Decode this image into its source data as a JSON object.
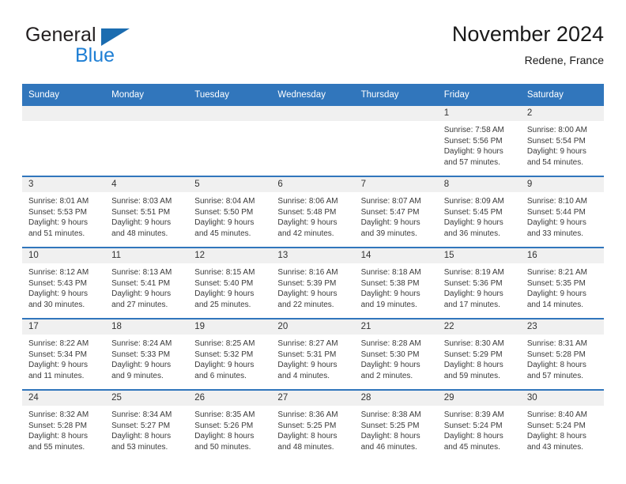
{
  "brand": {
    "line1": "General",
    "line2": "Blue",
    "logo_icon": "triangle-logo-icon",
    "accent_color": "#1f7fd4"
  },
  "header": {
    "title": "November 2024",
    "subtitle": "Redene, France"
  },
  "theme": {
    "header_blue": "#3176bc",
    "daynum_band": "#f0f0f0",
    "text": "#333333"
  },
  "calendar": {
    "weekday_headers": [
      "Sunday",
      "Monday",
      "Tuesday",
      "Wednesday",
      "Thursday",
      "Friday",
      "Saturday"
    ],
    "weeks": [
      [
        {
          "day": "",
          "sunrise": "",
          "sunset": "",
          "daylight": ""
        },
        {
          "day": "",
          "sunrise": "",
          "sunset": "",
          "daylight": ""
        },
        {
          "day": "",
          "sunrise": "",
          "sunset": "",
          "daylight": ""
        },
        {
          "day": "",
          "sunrise": "",
          "sunset": "",
          "daylight": ""
        },
        {
          "day": "",
          "sunrise": "",
          "sunset": "",
          "daylight": ""
        },
        {
          "day": "1",
          "sunrise": "Sunrise: 7:58 AM",
          "sunset": "Sunset: 5:56 PM",
          "daylight": "Daylight: 9 hours and 57 minutes."
        },
        {
          "day": "2",
          "sunrise": "Sunrise: 8:00 AM",
          "sunset": "Sunset: 5:54 PM",
          "daylight": "Daylight: 9 hours and 54 minutes."
        }
      ],
      [
        {
          "day": "3",
          "sunrise": "Sunrise: 8:01 AM",
          "sunset": "Sunset: 5:53 PM",
          "daylight": "Daylight: 9 hours and 51 minutes."
        },
        {
          "day": "4",
          "sunrise": "Sunrise: 8:03 AM",
          "sunset": "Sunset: 5:51 PM",
          "daylight": "Daylight: 9 hours and 48 minutes."
        },
        {
          "day": "5",
          "sunrise": "Sunrise: 8:04 AM",
          "sunset": "Sunset: 5:50 PM",
          "daylight": "Daylight: 9 hours and 45 minutes."
        },
        {
          "day": "6",
          "sunrise": "Sunrise: 8:06 AM",
          "sunset": "Sunset: 5:48 PM",
          "daylight": "Daylight: 9 hours and 42 minutes."
        },
        {
          "day": "7",
          "sunrise": "Sunrise: 8:07 AM",
          "sunset": "Sunset: 5:47 PM",
          "daylight": "Daylight: 9 hours and 39 minutes."
        },
        {
          "day": "8",
          "sunrise": "Sunrise: 8:09 AM",
          "sunset": "Sunset: 5:45 PM",
          "daylight": "Daylight: 9 hours and 36 minutes."
        },
        {
          "day": "9",
          "sunrise": "Sunrise: 8:10 AM",
          "sunset": "Sunset: 5:44 PM",
          "daylight": "Daylight: 9 hours and 33 minutes."
        }
      ],
      [
        {
          "day": "10",
          "sunrise": "Sunrise: 8:12 AM",
          "sunset": "Sunset: 5:43 PM",
          "daylight": "Daylight: 9 hours and 30 minutes."
        },
        {
          "day": "11",
          "sunrise": "Sunrise: 8:13 AM",
          "sunset": "Sunset: 5:41 PM",
          "daylight": "Daylight: 9 hours and 27 minutes."
        },
        {
          "day": "12",
          "sunrise": "Sunrise: 8:15 AM",
          "sunset": "Sunset: 5:40 PM",
          "daylight": "Daylight: 9 hours and 25 minutes."
        },
        {
          "day": "13",
          "sunrise": "Sunrise: 8:16 AM",
          "sunset": "Sunset: 5:39 PM",
          "daylight": "Daylight: 9 hours and 22 minutes."
        },
        {
          "day": "14",
          "sunrise": "Sunrise: 8:18 AM",
          "sunset": "Sunset: 5:38 PM",
          "daylight": "Daylight: 9 hours and 19 minutes."
        },
        {
          "day": "15",
          "sunrise": "Sunrise: 8:19 AM",
          "sunset": "Sunset: 5:36 PM",
          "daylight": "Daylight: 9 hours and 17 minutes."
        },
        {
          "day": "16",
          "sunrise": "Sunrise: 8:21 AM",
          "sunset": "Sunset: 5:35 PM",
          "daylight": "Daylight: 9 hours and 14 minutes."
        }
      ],
      [
        {
          "day": "17",
          "sunrise": "Sunrise: 8:22 AM",
          "sunset": "Sunset: 5:34 PM",
          "daylight": "Daylight: 9 hours and 11 minutes."
        },
        {
          "day": "18",
          "sunrise": "Sunrise: 8:24 AM",
          "sunset": "Sunset: 5:33 PM",
          "daylight": "Daylight: 9 hours and 9 minutes."
        },
        {
          "day": "19",
          "sunrise": "Sunrise: 8:25 AM",
          "sunset": "Sunset: 5:32 PM",
          "daylight": "Daylight: 9 hours and 6 minutes."
        },
        {
          "day": "20",
          "sunrise": "Sunrise: 8:27 AM",
          "sunset": "Sunset: 5:31 PM",
          "daylight": "Daylight: 9 hours and 4 minutes."
        },
        {
          "day": "21",
          "sunrise": "Sunrise: 8:28 AM",
          "sunset": "Sunset: 5:30 PM",
          "daylight": "Daylight: 9 hours and 2 minutes."
        },
        {
          "day": "22",
          "sunrise": "Sunrise: 8:30 AM",
          "sunset": "Sunset: 5:29 PM",
          "daylight": "Daylight: 8 hours and 59 minutes."
        },
        {
          "day": "23",
          "sunrise": "Sunrise: 8:31 AM",
          "sunset": "Sunset: 5:28 PM",
          "daylight": "Daylight: 8 hours and 57 minutes."
        }
      ],
      [
        {
          "day": "24",
          "sunrise": "Sunrise: 8:32 AM",
          "sunset": "Sunset: 5:28 PM",
          "daylight": "Daylight: 8 hours and 55 minutes."
        },
        {
          "day": "25",
          "sunrise": "Sunrise: 8:34 AM",
          "sunset": "Sunset: 5:27 PM",
          "daylight": "Daylight: 8 hours and 53 minutes."
        },
        {
          "day": "26",
          "sunrise": "Sunrise: 8:35 AM",
          "sunset": "Sunset: 5:26 PM",
          "daylight": "Daylight: 8 hours and 50 minutes."
        },
        {
          "day": "27",
          "sunrise": "Sunrise: 8:36 AM",
          "sunset": "Sunset: 5:25 PM",
          "daylight": "Daylight: 8 hours and 48 minutes."
        },
        {
          "day": "28",
          "sunrise": "Sunrise: 8:38 AM",
          "sunset": "Sunset: 5:25 PM",
          "daylight": "Daylight: 8 hours and 46 minutes."
        },
        {
          "day": "29",
          "sunrise": "Sunrise: 8:39 AM",
          "sunset": "Sunset: 5:24 PM",
          "daylight": "Daylight: 8 hours and 45 minutes."
        },
        {
          "day": "30",
          "sunrise": "Sunrise: 8:40 AM",
          "sunset": "Sunset: 5:24 PM",
          "daylight": "Daylight: 8 hours and 43 minutes."
        }
      ]
    ]
  }
}
